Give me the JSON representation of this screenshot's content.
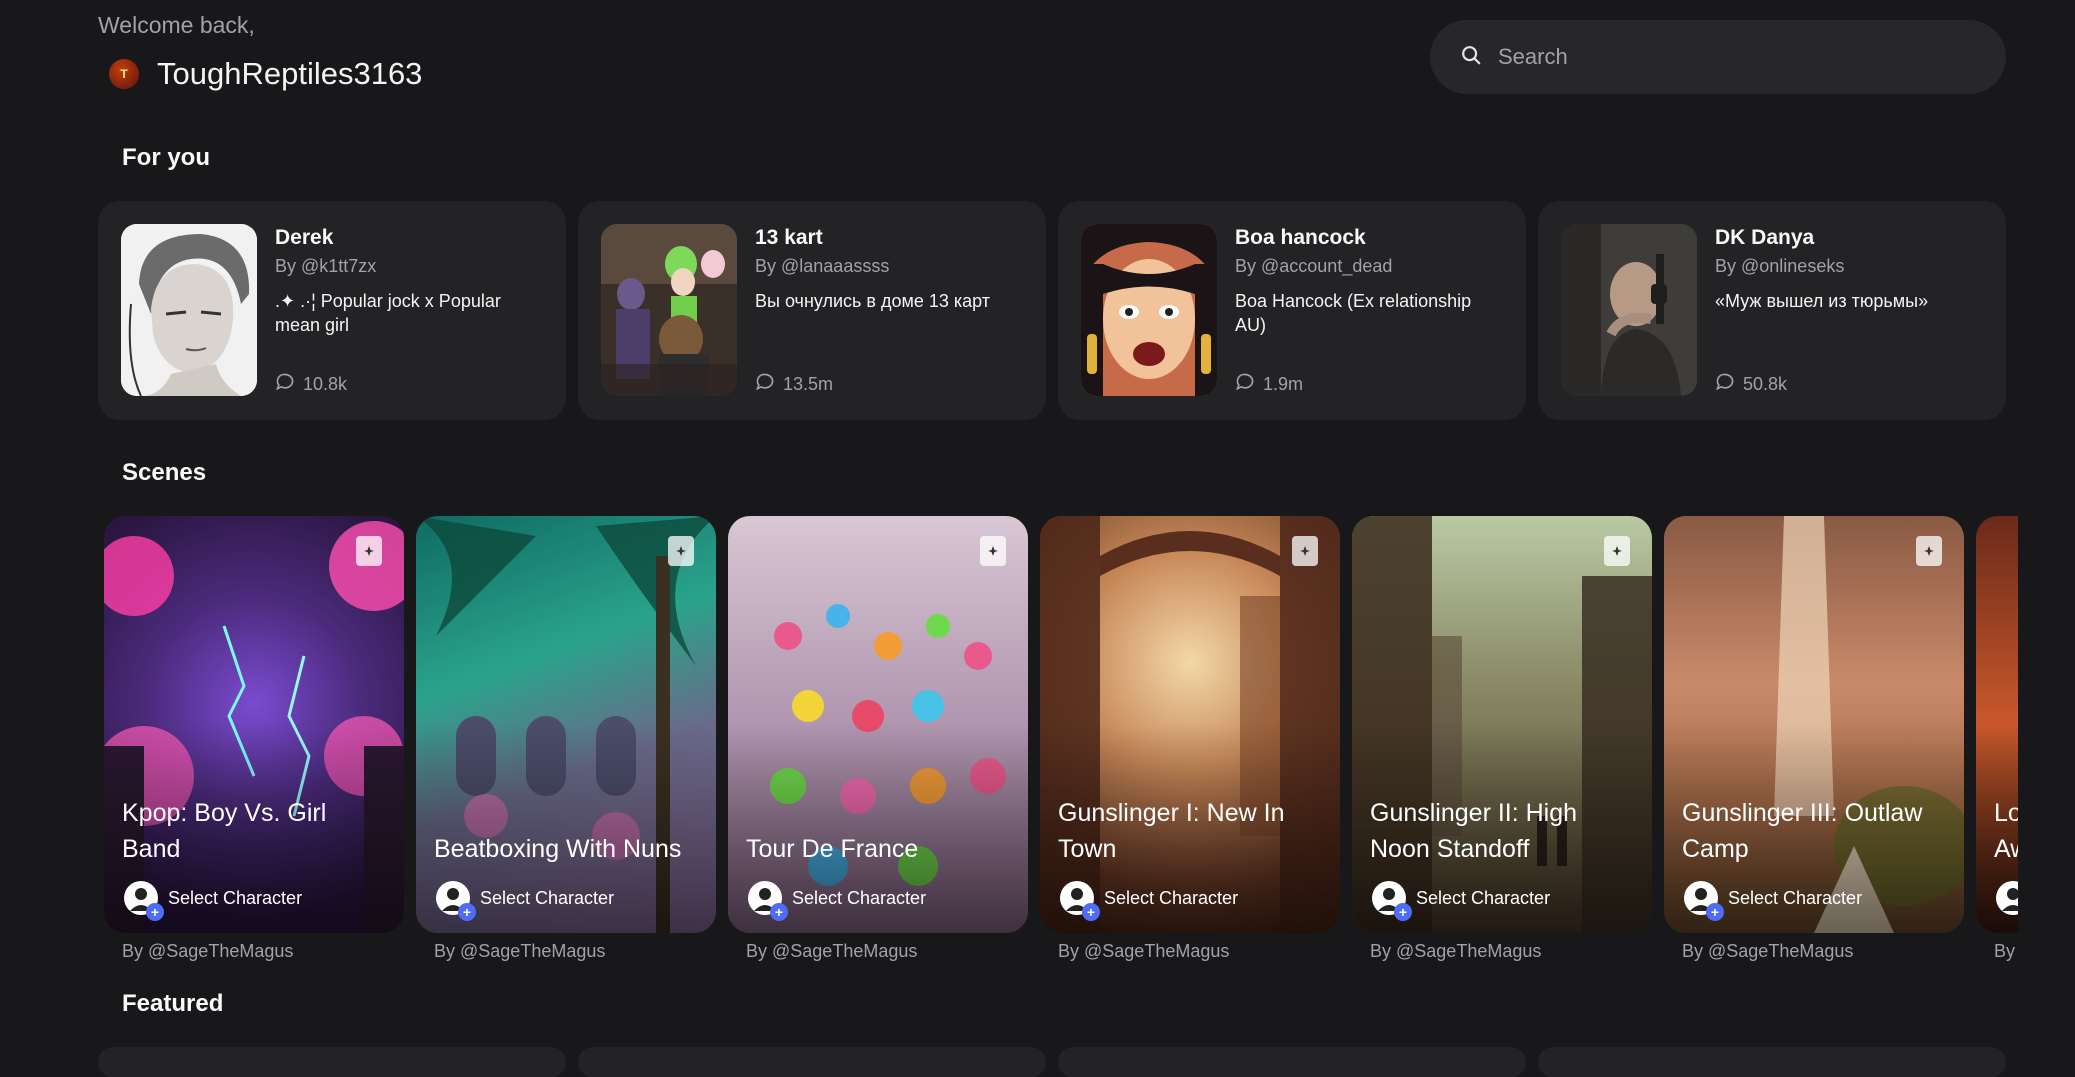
{
  "header": {
    "welcome": "Welcome back,",
    "avatar_initial": "T",
    "username": "ToughReptiles3163",
    "search_placeholder": "Search"
  },
  "sections": {
    "for_you": "For you",
    "scenes": "Scenes",
    "featured": "Featured"
  },
  "for_you": [
    {
      "name": "Derek",
      "author": "By @k1tt7zx",
      "description": ".✦ .·¦ Popular jock x Popular mean girl",
      "chats": "10.8k"
    },
    {
      "name": "13 kart",
      "author": "By @lanaaassss",
      "description": "Вы очнулись в доме 13 карт",
      "chats": "13.5m"
    },
    {
      "name": "Boa hancock",
      "author": "By @account_dead",
      "description": "Boa Hancock (Ex relationship AU)",
      "chats": "1.9m"
    },
    {
      "name": "DK Danya",
      "author": "By @onlineseks",
      "description": "«Муж вышел из тюрьмы»",
      "chats": "50.8k"
    }
  ],
  "scenes": [
    {
      "title": "Kpop: Boy Vs. Girl Band",
      "select": "Select Character",
      "author": "By @SageTheMagus"
    },
    {
      "title": "Beatboxing With Nuns",
      "select": "Select Character",
      "author": "By @SageTheMagus"
    },
    {
      "title": "Tour De France",
      "select": "Select Character",
      "author": "By @SageTheMagus"
    },
    {
      "title": "Gunslinger I: New In Town",
      "select": "Select Character",
      "author": "By @SageTheMagus"
    },
    {
      "title": "Gunslinger II: High Noon Standoff",
      "select": "Select Character",
      "author": "By @SageTheMagus"
    },
    {
      "title": "Gunslinger III: Outlaw Camp",
      "select": "Select Character",
      "author": "By @SageTheMagus"
    },
    {
      "title": "Lo Aw",
      "select": "Select Character",
      "author": "By"
    }
  ],
  "colors": {
    "background": "#18181b",
    "card": "#232326",
    "accent": "#4f6cf7"
  }
}
